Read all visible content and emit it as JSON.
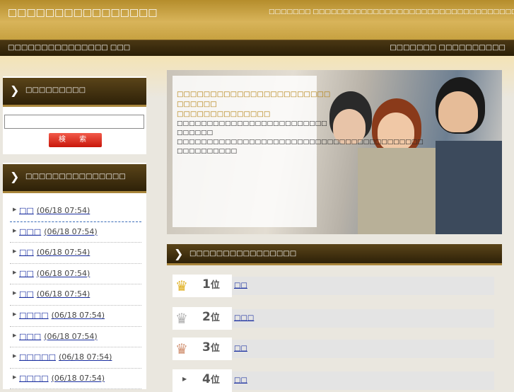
{
  "header": {
    "site_title": "□□□□□□□□□□□□□□□□",
    "description": "□□□□□□□ □□□□□□□□□□□□□□□□□□□□□□□□□□□□□□□□□□□"
  },
  "nav": {
    "left": "□□□□□□□□□□□□□□□ □□□",
    "right": "□□□□□□□ □□□□□□□□□□"
  },
  "search": {
    "title": "□□□□□□□□□",
    "button": "検 索",
    "value": ""
  },
  "latest": {
    "title": "□□□□□□□□□□□□□□□",
    "items": [
      {
        "label": "□□",
        "date": "(06/18 07:54)"
      },
      {
        "label": "□□□",
        "date": "(06/18 07:54)"
      },
      {
        "label": "□□",
        "date": "(06/18 07:54)"
      },
      {
        "label": "□□",
        "date": "(06/18 07:54)"
      },
      {
        "label": "□□",
        "date": "(06/18 07:54)"
      },
      {
        "label": "□□□□",
        "date": "(06/18 07:54)"
      },
      {
        "label": "□□□",
        "date": "(06/18 07:54)"
      },
      {
        "label": "□□□□□",
        "date": "(06/18 07:54)"
      },
      {
        "label": "□□□□",
        "date": "(06/18 07:54)"
      }
    ]
  },
  "hero": {
    "heading": "□□□□□□□□□□□□□□□□□□□□□□□ □□□□□□ □□□□□□□□□□□□□□",
    "body": "□□□□□□□□□□□□□□□□□□□□□□□□□ □□□□□□ □□□□□□□□□□□□□□□□□□□□□□□□□□□□□□□□□□□□□□□□□ □□□□□□□□□□"
  },
  "ranking": {
    "title": "□□□□□□□□□□□□□□□□",
    "suffix": "位",
    "rows": [
      {
        "rank": "1",
        "label": "□□",
        "crown_color": "#e0b020"
      },
      {
        "rank": "2",
        "label": "□□□",
        "crown_color": "#b0b0b0"
      },
      {
        "rank": "3",
        "label": "□□",
        "crown_color": "#d09070"
      },
      {
        "rank": "4",
        "label": "□□",
        "crown_color": ""
      }
    ]
  }
}
